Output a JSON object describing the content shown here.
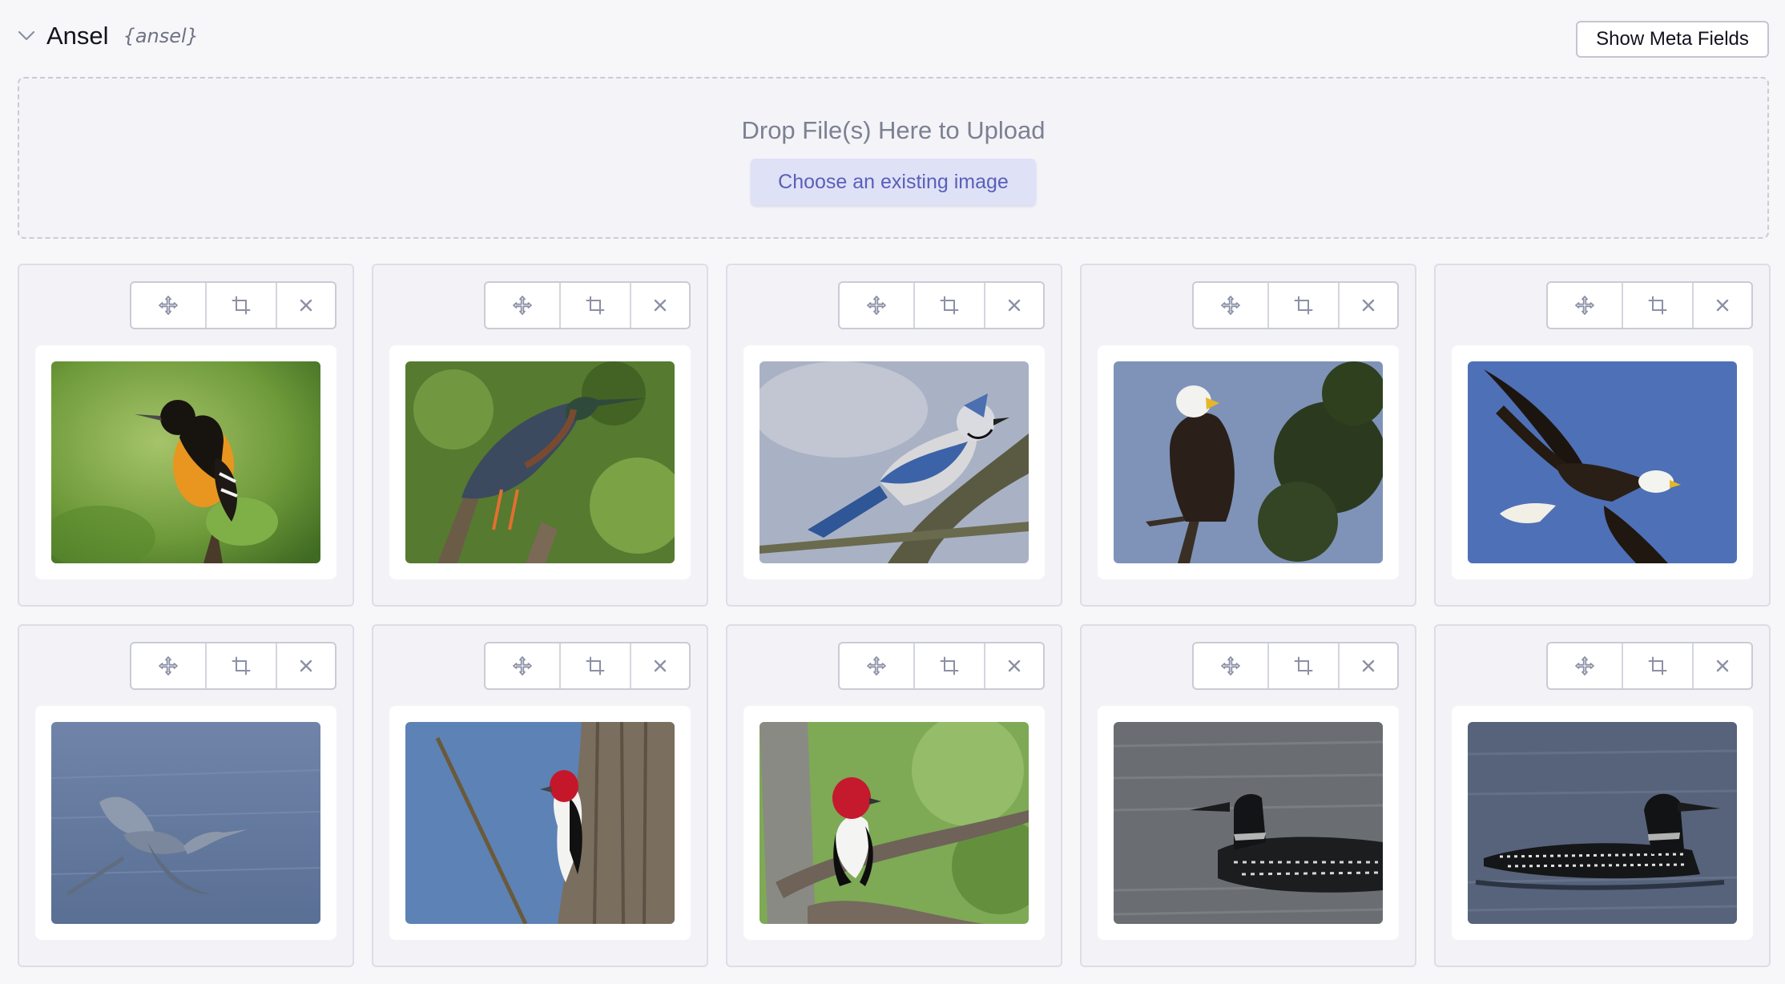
{
  "field": {
    "label": "Ansel",
    "handle": "{ansel}",
    "show_meta_label": "Show Meta Fields"
  },
  "dropzone": {
    "text": "Drop File(s) Here to Upload",
    "choose_label": "Choose an existing image"
  },
  "images": [
    {
      "subject": "oriole"
    },
    {
      "subject": "green-heron"
    },
    {
      "subject": "blue-jay"
    },
    {
      "subject": "eagle-perched"
    },
    {
      "subject": "eagle-flying"
    },
    {
      "subject": "great-blue-heron"
    },
    {
      "subject": "woodpecker-trunk"
    },
    {
      "subject": "woodpecker-branch"
    },
    {
      "subject": "loon-1"
    },
    {
      "subject": "loon-2"
    }
  ],
  "icons": {
    "collapse": "chevron-down-icon",
    "move": "move-icon",
    "crop": "crop-icon",
    "remove": "close-icon"
  },
  "colors": {
    "accent": "#5a5fb8",
    "accent_bg": "#dfe1f7",
    "icon": "#8c90a6"
  }
}
